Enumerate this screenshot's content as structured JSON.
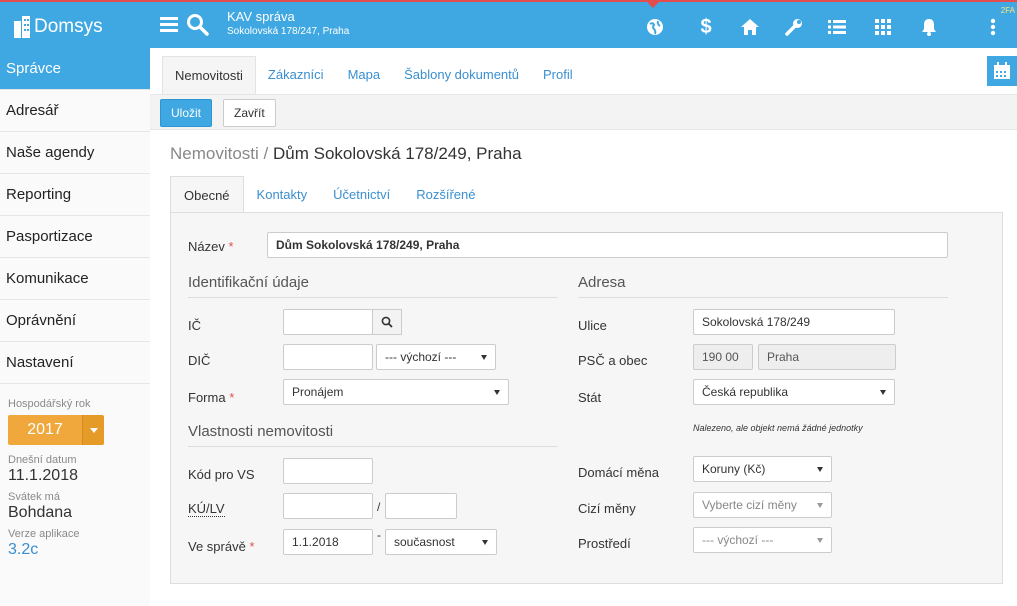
{
  "header": {
    "app_name": "Domsys",
    "context_title": "KAV správa",
    "context_subtitle": "Sokolovská 178/247, Praha",
    "badge": "2FA",
    "icons": [
      "globe-icon",
      "dollar-icon",
      "home-icon",
      "wrench-icon",
      "list-icon",
      "grid-icon",
      "bell-icon",
      "more-vertical-icon"
    ],
    "accent": "#3fa8e2",
    "alert_color": "#e44d4d"
  },
  "sidebar": {
    "items": [
      {
        "label": "Správce",
        "active": true
      },
      {
        "label": "Adresář"
      },
      {
        "label": "Naše agendy"
      },
      {
        "label": "Reporting"
      },
      {
        "label": "Pasportizace"
      },
      {
        "label": "Komunikace"
      },
      {
        "label": "Oprávnění"
      },
      {
        "label": "Nastavení"
      }
    ],
    "fiscal_year_label": "Hospodářský rok",
    "fiscal_year": "2017",
    "today_label": "Dnešní datum",
    "today": "11.1.2018",
    "nameday_label": "Svátek má",
    "nameday": "Bohdana",
    "version_label": "Verze aplikace",
    "version": "3.2c",
    "year_color": "#f0a83c"
  },
  "main": {
    "tabs": [
      {
        "label": "Nemovitosti",
        "active": true
      },
      {
        "label": "Zákazníci"
      },
      {
        "label": "Mapa"
      },
      {
        "label": "Šablony dokumentů"
      },
      {
        "label": "Profil"
      }
    ],
    "toolbar": {
      "save_label": "Uložit",
      "close_label": "Zavřít"
    },
    "breadcrumb_parent": "Nemovitosti /",
    "breadcrumb_current": "Dům Sokolovská 178/249, Praha",
    "subtabs": [
      {
        "label": "Obecné",
        "active": true
      },
      {
        "label": "Kontakty"
      },
      {
        "label": "Účetnictví"
      },
      {
        "label": "Rozšířené"
      }
    ]
  },
  "form": {
    "name_label": "Název",
    "name_value": "Dům Sokolovská 178/249, Praha",
    "ident_section": "Identifikační údaje",
    "ic_label": "IČ",
    "ic_value": "",
    "dic_label": "DIČ",
    "dic_value": "",
    "dic_select": "--- výchozí ---",
    "forma_label": "Forma",
    "forma_value": "Pronájem",
    "props_section": "Vlastnosti nemovitosti",
    "kod_label": "Kód pro VS",
    "kod_value": "",
    "kulv_label": "KÚ/LV",
    "kulv_sep": "/",
    "spravy_label": "Ve správě",
    "spravy_from": "1.1.2018",
    "spravy_sep": "-",
    "spravy_to": "současnost",
    "address_section": "Adresa",
    "ulice_label": "Ulice",
    "ulice_value": "Sokolovská 178/249",
    "psc_label": "PSČ a obec",
    "psc_value": "190 00",
    "obec_value": "Praha",
    "stat_label": "Stát",
    "stat_value": "Česká republika",
    "stat_note": "Nalezeno, ale objekt nemá žádné jednotky",
    "mena_label": "Domácí měna",
    "mena_value": "Koruny (Kč)",
    "cizi_label": "Cizí měny",
    "cizi_placeholder": "Vyberte cizí měny",
    "prostredi_label": "Prostředí",
    "prostredi_value": "--- výchozí ---",
    "required_mark": "*"
  }
}
